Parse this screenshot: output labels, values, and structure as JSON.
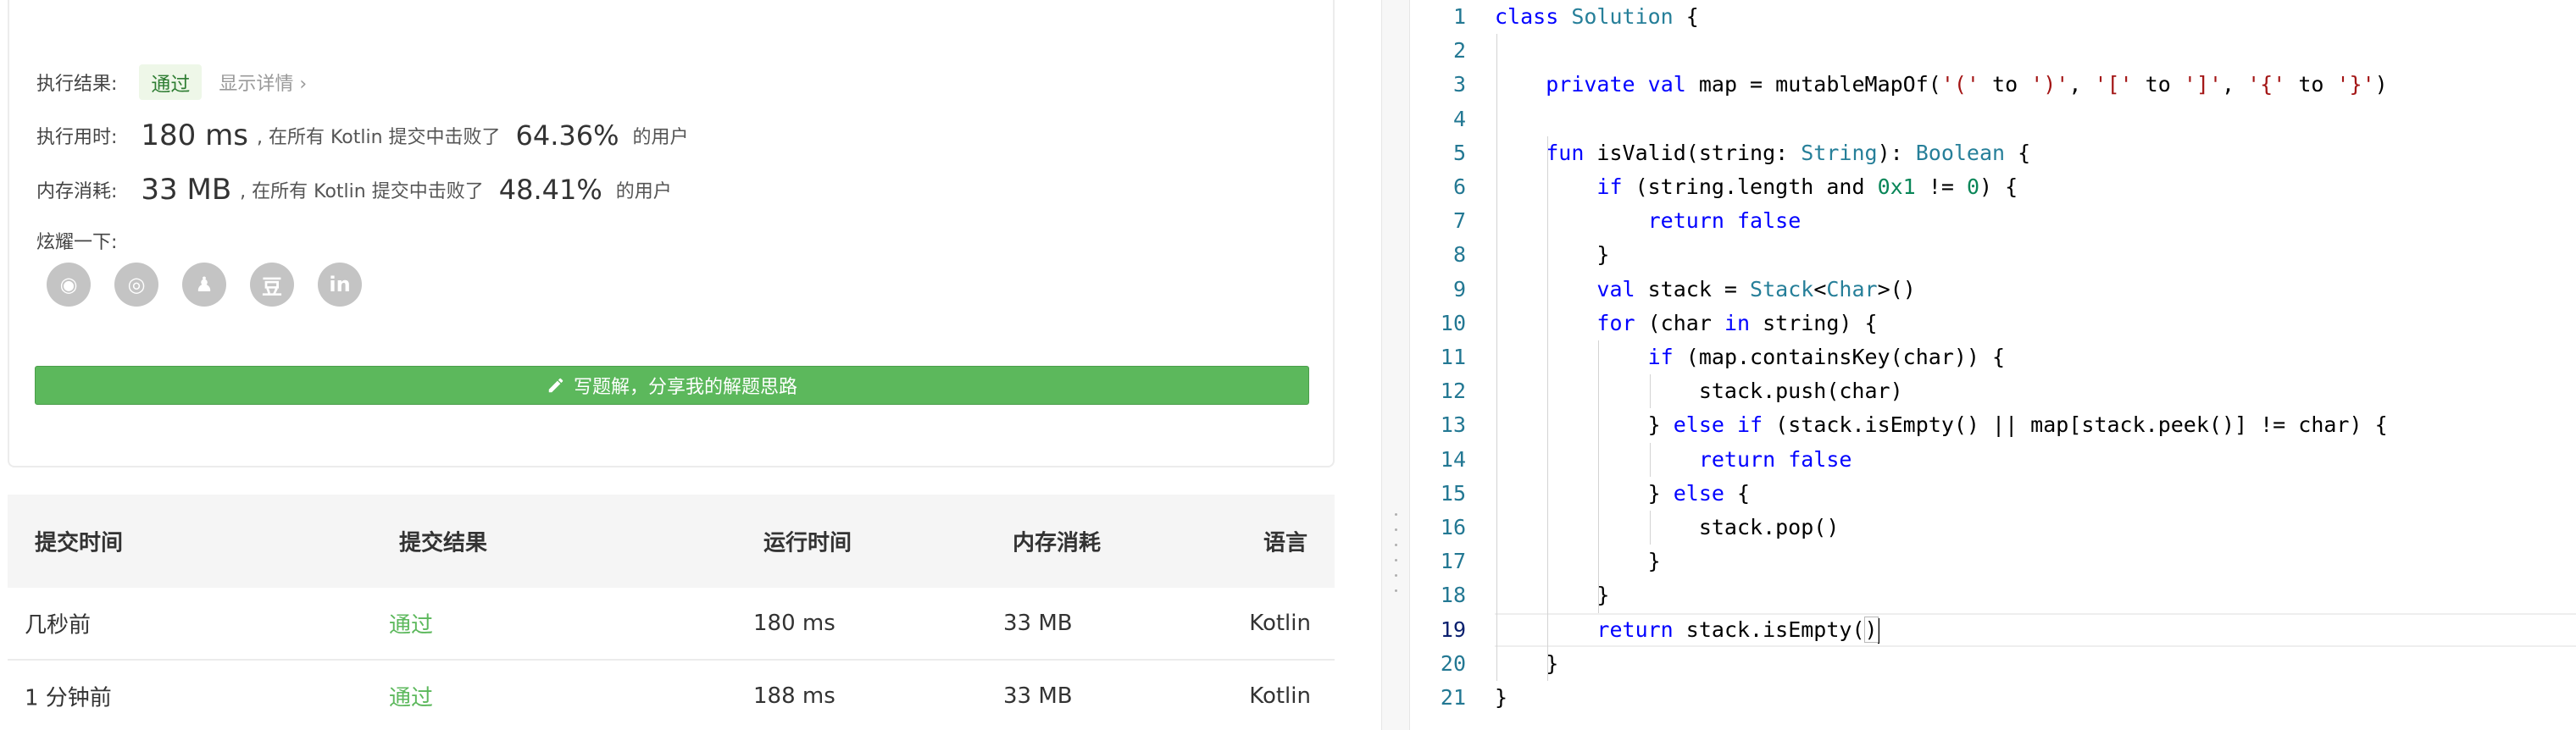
{
  "result": {
    "exec_result_label": "执行结果:",
    "status": "通过",
    "details_link": "显示详情 ›",
    "time_label": "执行用时:",
    "time_value": "180 ms",
    "time_text": ", 在所有 Kotlin 提交中击败了",
    "time_pct": "64.36%",
    "time_suffix": "的用户",
    "mem_label": "内存消耗:",
    "mem_value": "33 MB",
    "mem_text": ", 在所有 Kotlin 提交中击败了",
    "mem_pct": "48.41%",
    "mem_suffix": "的用户",
    "share_label": "炫耀一下:",
    "share_icons": [
      "wechat-icon",
      "weibo-icon",
      "qq-icon",
      "douban-icon",
      "linkedin-icon"
    ],
    "share_glyphs": [
      "◉",
      "◎",
      "♟",
      "豆",
      "in"
    ],
    "write_button": "写题解，分享我的解题思路"
  },
  "table": {
    "headers": [
      "提交时间",
      "提交结果",
      "运行时间",
      "内存消耗",
      "语言"
    ],
    "rows": [
      [
        "几秒前",
        "通过",
        "180 ms",
        "33 MB",
        "Kotlin"
      ],
      [
        "1 分钟前",
        "通过",
        "188 ms",
        "33 MB",
        "Kotlin"
      ]
    ]
  },
  "editor": {
    "active_line": 19,
    "line_numbers": [
      "1",
      "2",
      "3",
      "4",
      "5",
      "6",
      "7",
      "8",
      "9",
      "10",
      "11",
      "12",
      "13",
      "14",
      "15",
      "16",
      "17",
      "18",
      "19",
      "20",
      "21"
    ],
    "lines": [
      [
        [
          "kw",
          "class"
        ],
        [
          "",
          " "
        ],
        [
          "ty",
          "Solution"
        ],
        [
          "",
          " {"
        ]
      ],
      [],
      [
        [
          "",
          "    "
        ],
        [
          "kw",
          "private"
        ],
        [
          "",
          " "
        ],
        [
          "kw",
          "val"
        ],
        [
          "",
          " map = mutableMapOf("
        ],
        [
          "st",
          "'('"
        ],
        [
          "",
          " to "
        ],
        [
          "st",
          "')'"
        ],
        [
          "",
          ", "
        ],
        [
          "st",
          "'['"
        ],
        [
          "",
          " to "
        ],
        [
          "st",
          "']'"
        ],
        [
          "",
          ", "
        ],
        [
          "st",
          "'{'"
        ],
        [
          "",
          " to "
        ],
        [
          "st",
          "'}'"
        ],
        [
          "",
          ")"
        ]
      ],
      [],
      [
        [
          "",
          "    "
        ],
        [
          "kw",
          "fun"
        ],
        [
          "",
          " isValid(string: "
        ],
        [
          "ty",
          "String"
        ],
        [
          "",
          "): "
        ],
        [
          "ty",
          "Boolean"
        ],
        [
          "",
          " {"
        ]
      ],
      [
        [
          "",
          "        "
        ],
        [
          "kw",
          "if"
        ],
        [
          "",
          " (string.length and "
        ],
        [
          "nm",
          "0x1"
        ],
        [
          "",
          " != "
        ],
        [
          "nm",
          "0"
        ],
        [
          "",
          ") {"
        ]
      ],
      [
        [
          "",
          "            "
        ],
        [
          "kw",
          "return"
        ],
        [
          "",
          " "
        ],
        [
          "kw",
          "false"
        ]
      ],
      [
        [
          "",
          "        }"
        ]
      ],
      [
        [
          "",
          "        "
        ],
        [
          "kw",
          "val"
        ],
        [
          "",
          " stack = "
        ],
        [
          "ty",
          "Stack"
        ],
        [
          "",
          "<"
        ],
        [
          "ty",
          "Char"
        ],
        [
          "",
          ">()"
        ]
      ],
      [
        [
          "",
          "        "
        ],
        [
          "kw",
          "for"
        ],
        [
          "",
          " (char "
        ],
        [
          "kw",
          "in"
        ],
        [
          "",
          " string) {"
        ]
      ],
      [
        [
          "",
          "            "
        ],
        [
          "kw",
          "if"
        ],
        [
          "",
          " (map.containsKey(char)) {"
        ]
      ],
      [
        [
          "",
          "                stack.push(char)"
        ]
      ],
      [
        [
          "",
          "            } "
        ],
        [
          "kw",
          "else"
        ],
        [
          "",
          " "
        ],
        [
          "kw",
          "if"
        ],
        [
          "",
          " (stack.isEmpty() || map[stack.peek()] != char) {"
        ]
      ],
      [
        [
          "",
          "                "
        ],
        [
          "kw",
          "return"
        ],
        [
          "",
          " "
        ],
        [
          "kw",
          "false"
        ]
      ],
      [
        [
          "",
          "            } "
        ],
        [
          "kw",
          "else"
        ],
        [
          "",
          " {"
        ]
      ],
      [
        [
          "",
          "                stack.pop()"
        ]
      ],
      [
        [
          "",
          "            }"
        ]
      ],
      [
        [
          "",
          "        }"
        ]
      ],
      [
        [
          "",
          "        "
        ],
        [
          "kw",
          "return"
        ],
        [
          "",
          " stack.isEmpty("
        ],
        [
          "bm",
          ")"
        ]
      ],
      [
        [
          "",
          "    }"
        ]
      ],
      [
        [
          "",
          "}"
        ]
      ]
    ]
  }
}
